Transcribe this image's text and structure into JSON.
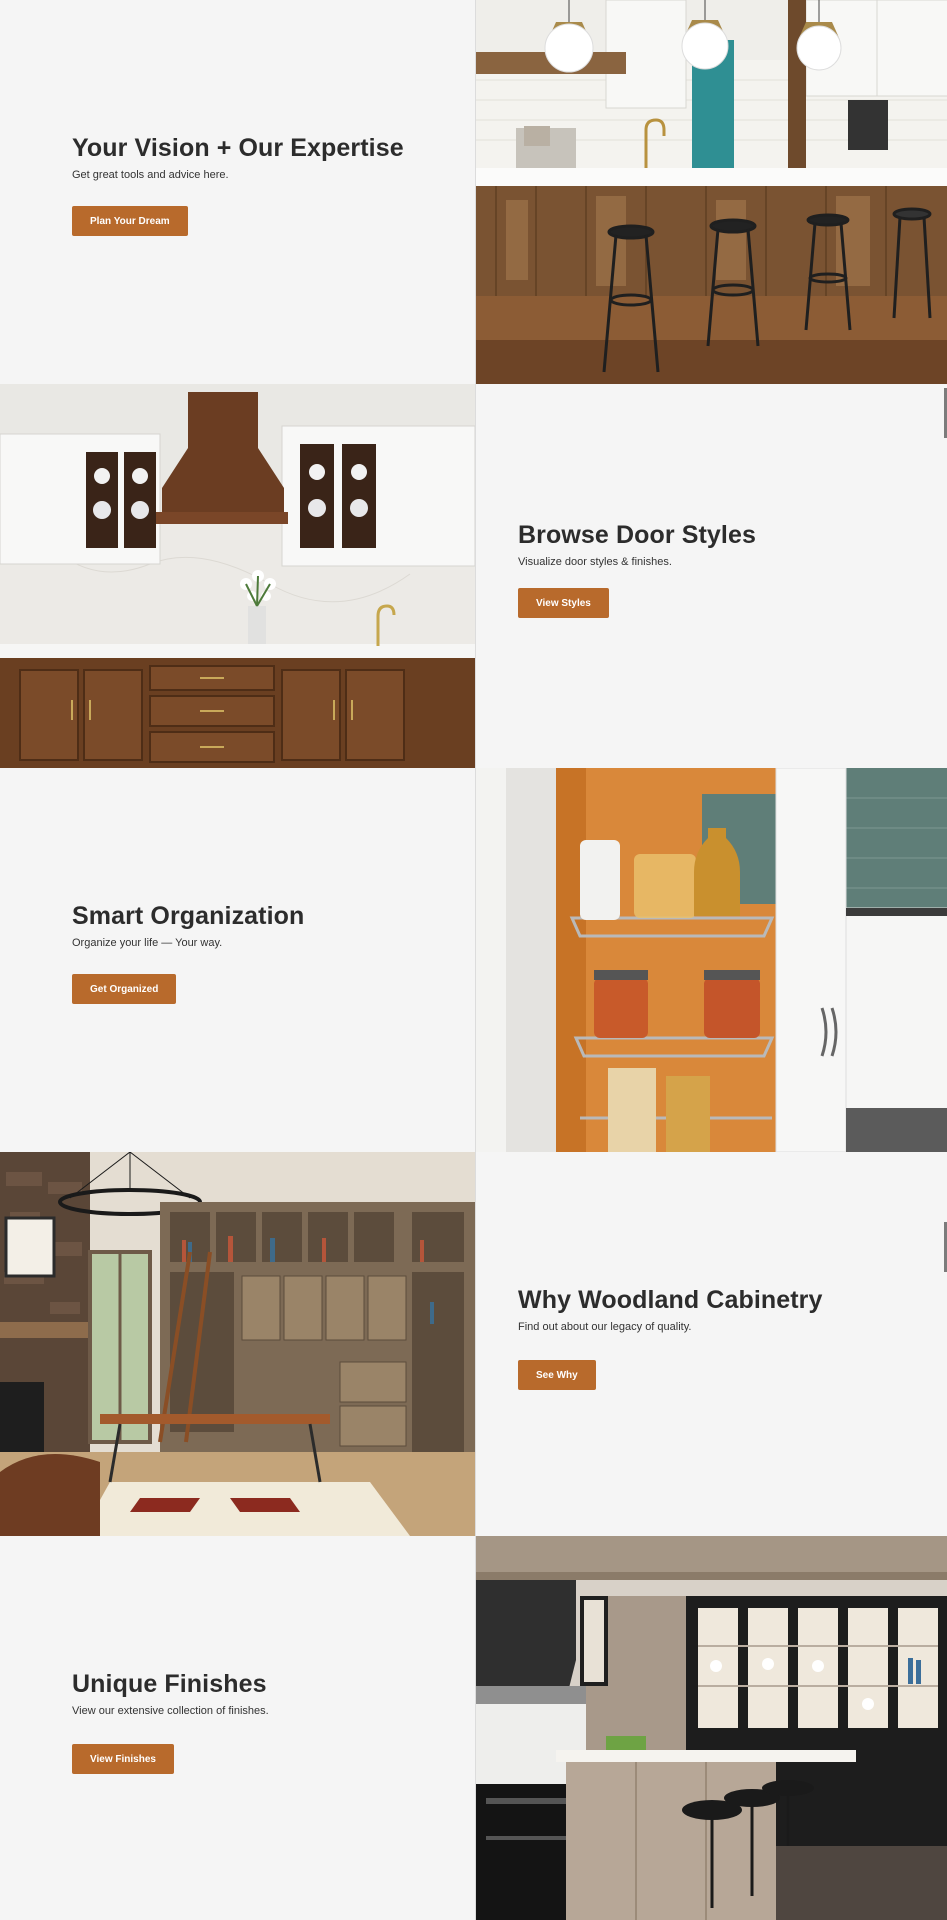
{
  "sections": [
    {
      "heading": "Your Vision + Our Expertise",
      "subtext": "Get great tools and advice here.",
      "button_label": "Plan Your Dream",
      "image": "kitchen-island-with-bar-stools"
    },
    {
      "heading": "Browse Door Styles",
      "subtext": "Visualize door styles & finishes.",
      "button_label": "View Styles",
      "image": "walnut-kitchen-with-range-hood"
    },
    {
      "heading": "Smart Organization",
      "subtext": "Organize your life — Your way.",
      "button_label": "Get Organized",
      "image": "pull-out-pantry-shelves"
    },
    {
      "heading": "Why Woodland Cabinetry",
      "subtext": "Find out about our legacy of quality.",
      "button_label": "See Why",
      "image": "home-office-library-cabinets"
    },
    {
      "heading": "Unique Finishes",
      "subtext": "View our extensive collection of finishes.",
      "button_label": "View Finishes",
      "image": "gray-wood-kitchen-with-glass-cabinets"
    }
  ],
  "colors": {
    "button": "#b86a2c",
    "background": "#f5f5f5",
    "heading": "#2c2c2c"
  }
}
